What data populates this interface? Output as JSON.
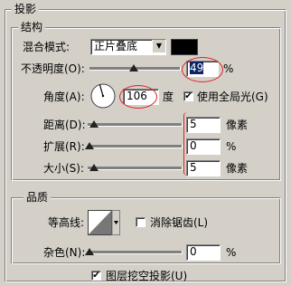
{
  "panel": {
    "title": "投影"
  },
  "structure": {
    "title": "结构",
    "blend_mode": {
      "label": "混合模式:",
      "value": "正片叠底"
    },
    "blend_color": "#000000",
    "opacity": {
      "label": "不透明度(O):",
      "value": "49",
      "unit": "%",
      "percent": 49
    },
    "angle": {
      "label": "角度(A):",
      "value": "106",
      "unit": "度"
    },
    "global_light": {
      "label": "使用全局光(G)",
      "checked": true
    },
    "distance": {
      "label": "距离(D):",
      "value": "5",
      "unit": "像素"
    },
    "spread": {
      "label": "扩展(R):",
      "value": "0",
      "unit": "%"
    },
    "size": {
      "label": "大小(S):",
      "value": "5",
      "unit": "像素"
    }
  },
  "quality": {
    "title": "品质",
    "contour": {
      "label": "等高线:"
    },
    "anti_alias": {
      "label": "消除锯齿(L)",
      "checked": false
    },
    "noise": {
      "label": "杂色(N):",
      "value": "0",
      "unit": "%"
    }
  },
  "knockout": {
    "label": "图层挖空投影(U)",
    "checked": true
  },
  "colors": {
    "highlight_red": "#e02020",
    "selected_value_bg": "#0a246a"
  }
}
